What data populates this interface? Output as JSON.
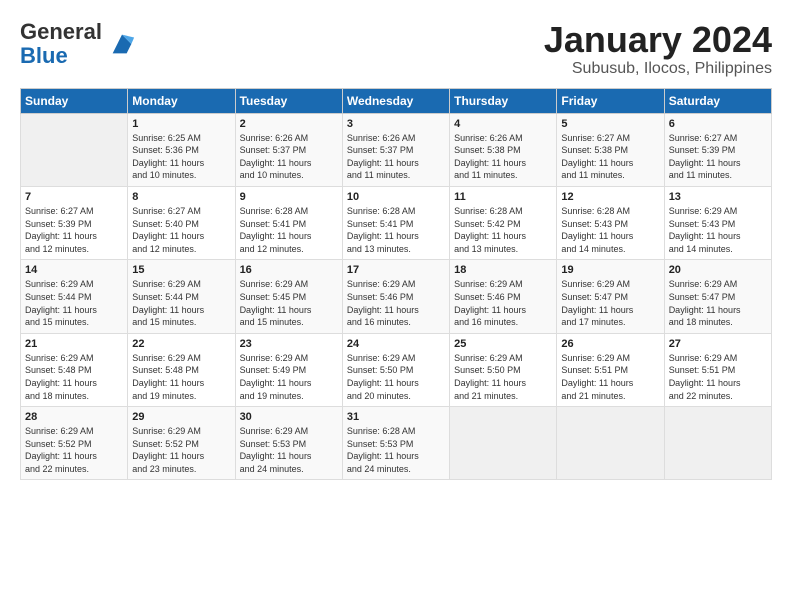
{
  "logo": {
    "line1": "General",
    "line2": "Blue"
  },
  "title": "January 2024",
  "subtitle": "Subusub, Ilocos, Philippines",
  "header": {
    "days": [
      "Sunday",
      "Monday",
      "Tuesday",
      "Wednesday",
      "Thursday",
      "Friday",
      "Saturday"
    ]
  },
  "weeks": [
    [
      {
        "num": "",
        "info": ""
      },
      {
        "num": "1",
        "info": "Sunrise: 6:25 AM\nSunset: 5:36 PM\nDaylight: 11 hours\nand 10 minutes."
      },
      {
        "num": "2",
        "info": "Sunrise: 6:26 AM\nSunset: 5:37 PM\nDaylight: 11 hours\nand 10 minutes."
      },
      {
        "num": "3",
        "info": "Sunrise: 6:26 AM\nSunset: 5:37 PM\nDaylight: 11 hours\nand 11 minutes."
      },
      {
        "num": "4",
        "info": "Sunrise: 6:26 AM\nSunset: 5:38 PM\nDaylight: 11 hours\nand 11 minutes."
      },
      {
        "num": "5",
        "info": "Sunrise: 6:27 AM\nSunset: 5:38 PM\nDaylight: 11 hours\nand 11 minutes."
      },
      {
        "num": "6",
        "info": "Sunrise: 6:27 AM\nSunset: 5:39 PM\nDaylight: 11 hours\nand 11 minutes."
      }
    ],
    [
      {
        "num": "7",
        "info": "Sunrise: 6:27 AM\nSunset: 5:39 PM\nDaylight: 11 hours\nand 12 minutes."
      },
      {
        "num": "8",
        "info": "Sunrise: 6:27 AM\nSunset: 5:40 PM\nDaylight: 11 hours\nand 12 minutes."
      },
      {
        "num": "9",
        "info": "Sunrise: 6:28 AM\nSunset: 5:41 PM\nDaylight: 11 hours\nand 12 minutes."
      },
      {
        "num": "10",
        "info": "Sunrise: 6:28 AM\nSunset: 5:41 PM\nDaylight: 11 hours\nand 13 minutes."
      },
      {
        "num": "11",
        "info": "Sunrise: 6:28 AM\nSunset: 5:42 PM\nDaylight: 11 hours\nand 13 minutes."
      },
      {
        "num": "12",
        "info": "Sunrise: 6:28 AM\nSunset: 5:43 PM\nDaylight: 11 hours\nand 14 minutes."
      },
      {
        "num": "13",
        "info": "Sunrise: 6:29 AM\nSunset: 5:43 PM\nDaylight: 11 hours\nand 14 minutes."
      }
    ],
    [
      {
        "num": "14",
        "info": "Sunrise: 6:29 AM\nSunset: 5:44 PM\nDaylight: 11 hours\nand 15 minutes."
      },
      {
        "num": "15",
        "info": "Sunrise: 6:29 AM\nSunset: 5:44 PM\nDaylight: 11 hours\nand 15 minutes."
      },
      {
        "num": "16",
        "info": "Sunrise: 6:29 AM\nSunset: 5:45 PM\nDaylight: 11 hours\nand 15 minutes."
      },
      {
        "num": "17",
        "info": "Sunrise: 6:29 AM\nSunset: 5:46 PM\nDaylight: 11 hours\nand 16 minutes."
      },
      {
        "num": "18",
        "info": "Sunrise: 6:29 AM\nSunset: 5:46 PM\nDaylight: 11 hours\nand 16 minutes."
      },
      {
        "num": "19",
        "info": "Sunrise: 6:29 AM\nSunset: 5:47 PM\nDaylight: 11 hours\nand 17 minutes."
      },
      {
        "num": "20",
        "info": "Sunrise: 6:29 AM\nSunset: 5:47 PM\nDaylight: 11 hours\nand 18 minutes."
      }
    ],
    [
      {
        "num": "21",
        "info": "Sunrise: 6:29 AM\nSunset: 5:48 PM\nDaylight: 11 hours\nand 18 minutes."
      },
      {
        "num": "22",
        "info": "Sunrise: 6:29 AM\nSunset: 5:48 PM\nDaylight: 11 hours\nand 19 minutes."
      },
      {
        "num": "23",
        "info": "Sunrise: 6:29 AM\nSunset: 5:49 PM\nDaylight: 11 hours\nand 19 minutes."
      },
      {
        "num": "24",
        "info": "Sunrise: 6:29 AM\nSunset: 5:50 PM\nDaylight: 11 hours\nand 20 minutes."
      },
      {
        "num": "25",
        "info": "Sunrise: 6:29 AM\nSunset: 5:50 PM\nDaylight: 11 hours\nand 21 minutes."
      },
      {
        "num": "26",
        "info": "Sunrise: 6:29 AM\nSunset: 5:51 PM\nDaylight: 11 hours\nand 21 minutes."
      },
      {
        "num": "27",
        "info": "Sunrise: 6:29 AM\nSunset: 5:51 PM\nDaylight: 11 hours\nand 22 minutes."
      }
    ],
    [
      {
        "num": "28",
        "info": "Sunrise: 6:29 AM\nSunset: 5:52 PM\nDaylight: 11 hours\nand 22 minutes."
      },
      {
        "num": "29",
        "info": "Sunrise: 6:29 AM\nSunset: 5:52 PM\nDaylight: 11 hours\nand 23 minutes."
      },
      {
        "num": "30",
        "info": "Sunrise: 6:29 AM\nSunset: 5:53 PM\nDaylight: 11 hours\nand 24 minutes."
      },
      {
        "num": "31",
        "info": "Sunrise: 6:28 AM\nSunset: 5:53 PM\nDaylight: 11 hours\nand 24 minutes."
      },
      {
        "num": "",
        "info": ""
      },
      {
        "num": "",
        "info": ""
      },
      {
        "num": "",
        "info": ""
      }
    ]
  ]
}
